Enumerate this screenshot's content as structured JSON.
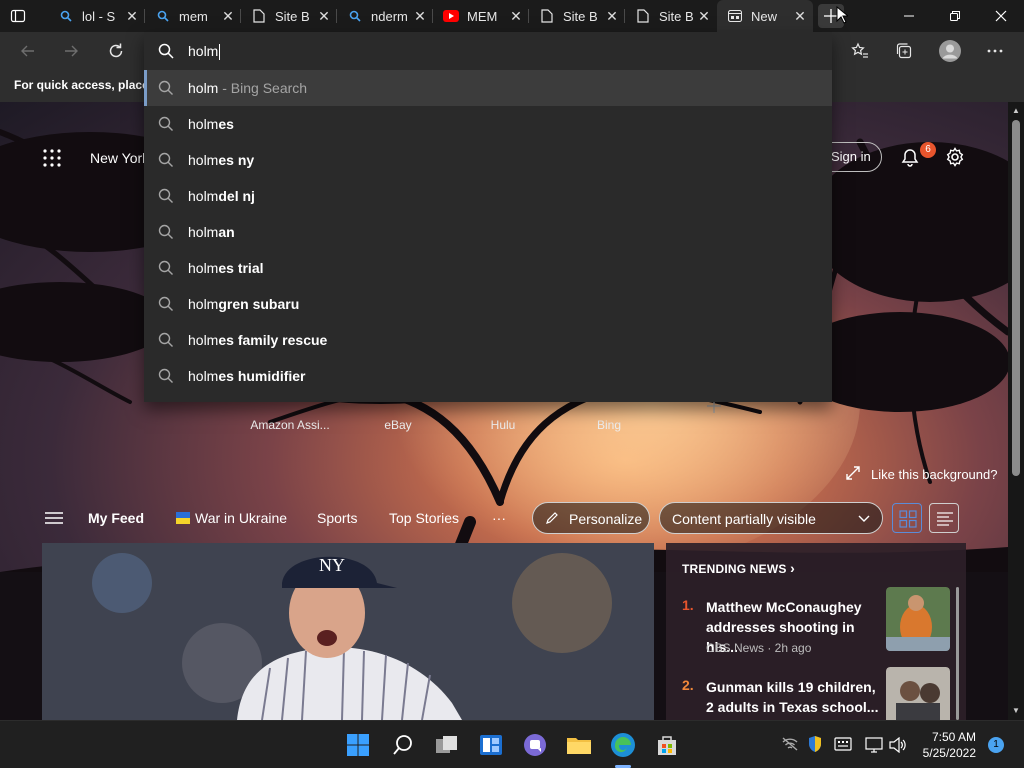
{
  "tabs": [
    {
      "title": "lol - S",
      "icon": "search-icon",
      "icon_color": "#4aa3f0"
    },
    {
      "title": "mem",
      "icon": "search-icon",
      "icon_color": "#4aa3f0"
    },
    {
      "title": "Site B",
      "icon": "page-icon",
      "icon_color": "#e6e6e6"
    },
    {
      "title": "nderm",
      "icon": "search-icon",
      "icon_color": "#4aa3f0"
    },
    {
      "title": "MEM",
      "icon": "youtube-icon",
      "icon_color": "#ff0000"
    },
    {
      "title": "Site B",
      "icon": "page-icon",
      "icon_color": "#e6e6e6"
    },
    {
      "title": "Site B",
      "icon": "page-icon",
      "icon_color": "#e6e6e6"
    },
    {
      "title": "New",
      "icon": "new-tab-icon",
      "icon_color": "#e6e6e6",
      "active": true
    }
  ],
  "close_glyph": "✕",
  "address": {
    "query": "holm"
  },
  "favbar_text": "For quick access, place y",
  "suggestions": [
    {
      "typed": "holm",
      "rest": "",
      "hint": " - Bing Search",
      "highlighted": true
    },
    {
      "typed": "holm",
      "rest": "es"
    },
    {
      "typed": "holm",
      "rest": "es ny"
    },
    {
      "typed": "holm",
      "rest": "del nj"
    },
    {
      "typed": "holm",
      "rest": "an"
    },
    {
      "typed": "holm",
      "rest": "es trial"
    },
    {
      "typed": "holm",
      "rest": "gren subaru"
    },
    {
      "typed": "holm",
      "rest": "es family rescue"
    },
    {
      "typed": "holm",
      "rest": "es humidifier"
    }
  ],
  "page": {
    "location": "New York",
    "signin": "Sign in",
    "notif_count": "6",
    "quick_links": [
      "Amazon Assi...",
      "eBay",
      "Hulu",
      "Bing"
    ],
    "like_bg": "Like this background?",
    "feed": {
      "my_feed": "My Feed",
      "ukraine": "War in Ukraine",
      "sports": "Sports",
      "top_stories": "Top Stories",
      "more": "···",
      "personalize": "Personalize",
      "visibility": "Content partially visible"
    },
    "trending": {
      "title": "TRENDING NEWS",
      "items": [
        {
          "num": "1.",
          "headline": "Matthew McConaughey addresses shooting in his...",
          "source": "CBS News · 2h ago",
          "num_color": "#e8552d"
        },
        {
          "num": "2.",
          "headline": "Gunman kills 19 children, 2 adults in Texas school...",
          "source": "",
          "num_color": "#f0883a"
        }
      ]
    }
  },
  "taskbar": {
    "time": "7:50 AM",
    "date": "5/25/2022",
    "notif_count": "1"
  },
  "colors": {
    "accent": "#4aa3f0",
    "badge": "#e8552d"
  }
}
